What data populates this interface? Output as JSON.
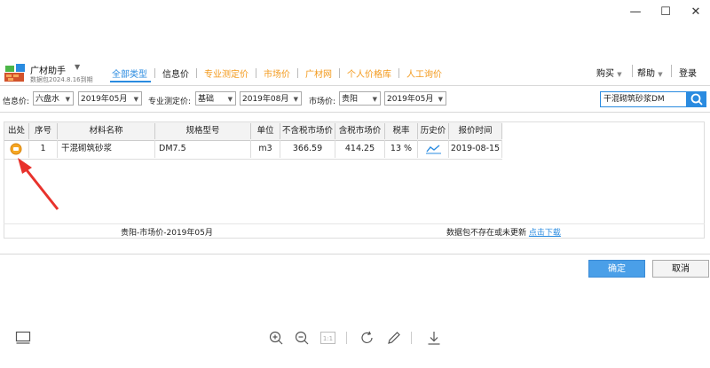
{
  "window": {
    "minimize": "—",
    "maximize": "☐",
    "close": "✕"
  },
  "app": {
    "name": "广材助手",
    "data_pack": "数据包2024.8.16到期"
  },
  "tabs": [
    {
      "label": "全部类型"
    },
    {
      "label": "信息价"
    },
    {
      "label": "专业测定价"
    },
    {
      "label": "市场价"
    },
    {
      "label": "广材网"
    },
    {
      "label": "个人价格库"
    },
    {
      "label": "人工询价"
    }
  ],
  "top_right": {
    "buy": "购买",
    "help": "帮助",
    "login": "登录"
  },
  "filters": {
    "info_price_label": "信息价:",
    "info_price_region": "六盘水",
    "info_price_period": "2019年05月",
    "professional_label": "专业测定价:",
    "professional_type": "基础",
    "professional_period": "2019年08月",
    "market_label": "市场价:",
    "market_region": "贵阳",
    "market_period": "2019年05月"
  },
  "search": {
    "value": "干混砌筑砂浆DM"
  },
  "table": {
    "headers": [
      "出处",
      "序号",
      "材料名称",
      "规格型号",
      "单位",
      "不含税市场价",
      "含税市场价",
      "税率",
      "历史价",
      "报价时间"
    ],
    "rows": [
      {
        "source_icon": "price-source-icon",
        "index": "1",
        "name": "干混砌筑砂浆",
        "spec": "DM7.5",
        "unit": "m3",
        "price_ex_tax": "366.59",
        "price_inc_tax": "414.25",
        "tax_rate": "13 %",
        "history_icon": "trend-chart-icon",
        "quote_date": "2019-08-15"
      }
    ]
  },
  "status": {
    "source": "贵阳-市场价-2019年05月",
    "notice": "数据包不存在或未更新",
    "link": "点击下载"
  },
  "buttons": {
    "ok": "确定",
    "cancel": "取消"
  },
  "viewer": {
    "page_indicator": "1:1"
  },
  "colors": {
    "accent": "#2a8be0",
    "tab_orange": "#f39a1d",
    "arrow_red": "#e8322c"
  }
}
